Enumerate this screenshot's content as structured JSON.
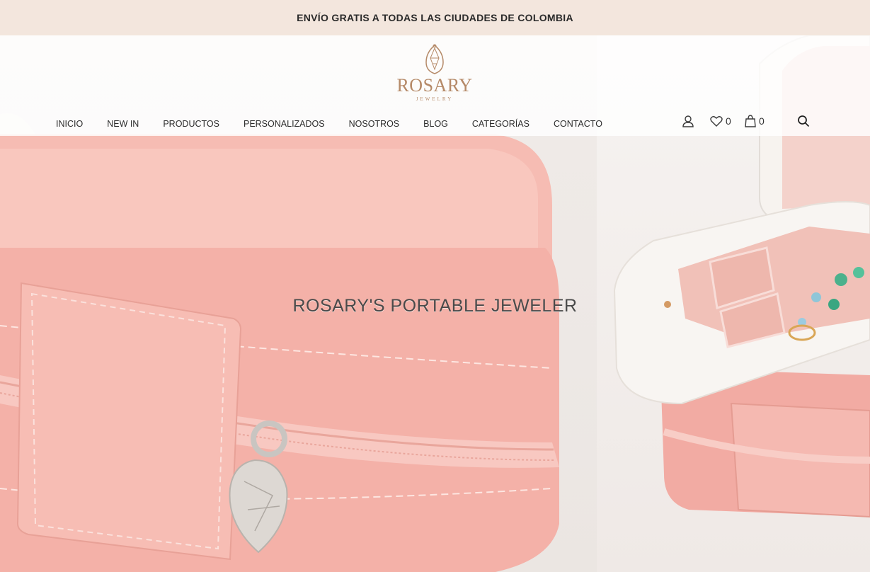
{
  "announcement": "ENVÍO GRATIS A TODAS LAS CIUDADES DE COLOMBIA",
  "brand": {
    "name": "ROSARY",
    "subtitle": "JEWELRY"
  },
  "nav": [
    "INICIO",
    "NEW IN",
    "PRODUCTOS",
    "PERSONALIZADOS",
    "NOSOTROS",
    "BLOG",
    "CATEGORÍAS",
    "CONTACTO"
  ],
  "header_icons": {
    "account": "user-icon",
    "wishlist": "heart-icon",
    "wishlist_count": "0",
    "cart": "bag-icon",
    "cart_count": "0",
    "search": "search-icon"
  },
  "hero": {
    "title": "ROSARY'S PORTABLE JEWELER"
  },
  "colors": {
    "announcement_bg": "#f3e6dd",
    "brand_gold": "#b58a68",
    "case_pink": "#f5b3ab",
    "case_white": "#f7f4f1"
  }
}
